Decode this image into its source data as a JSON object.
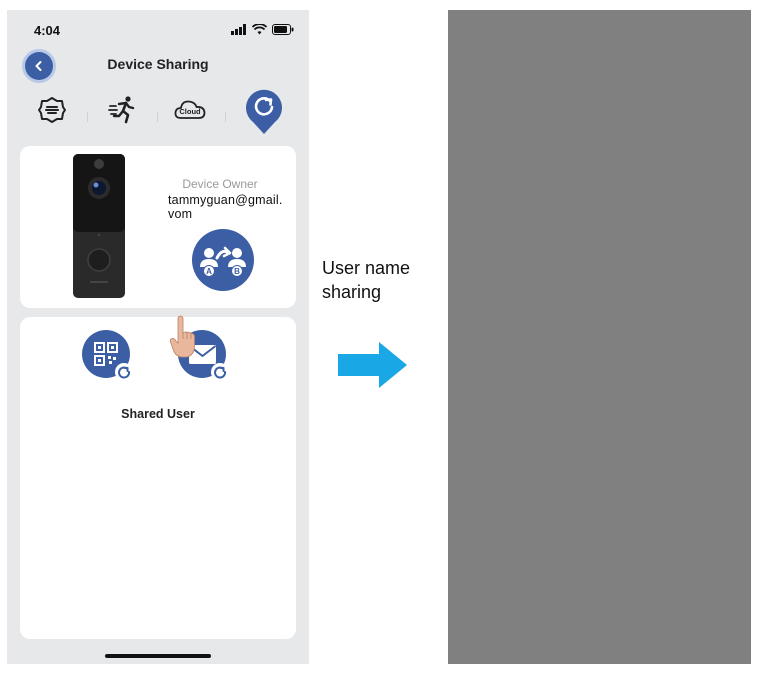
{
  "status_bar": {
    "time": "4:04"
  },
  "header": {
    "title": "Device Sharing"
  },
  "toolbar_icons": [
    "menu-icon",
    "motion-icon",
    "cloud-icon",
    "share-icon"
  ],
  "cloud_icon_text": "Cloud",
  "owner_card": {
    "label": "Device Owner",
    "email": "tammyguan@gmail.vom",
    "transfer_badges": [
      "A",
      "B"
    ]
  },
  "shared_card": {
    "label": "Shared User"
  },
  "annotation": {
    "line1": "User name",
    "line2": "sharing"
  },
  "colors": {
    "accent": "#3c5ea5",
    "arrow": "#1aa7e6",
    "background": "#e6e8ea",
    "right_panel": "#808080"
  }
}
